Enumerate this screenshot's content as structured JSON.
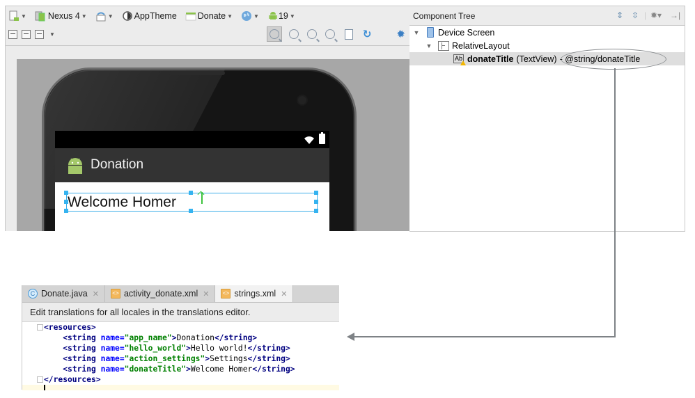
{
  "designer": {
    "toolbar_row1": {
      "device": "Nexus 4",
      "theme": "AppTheme",
      "activity": "Donate",
      "api_level": "19"
    },
    "toolbar_row2": {
      "icons": [
        "zoom-to-fit",
        "actual-size",
        "zoom-in",
        "zoom-out",
        "screenshot",
        "refresh",
        "settings"
      ]
    },
    "preview": {
      "app_title": "Donation",
      "selected_text": "Welcome Homer"
    }
  },
  "component_tree": {
    "title": "Component Tree",
    "items": [
      {
        "label": "Device Screen",
        "level": 0
      },
      {
        "label": "RelativeLayout",
        "level": 1
      },
      {
        "label": "donateTitle",
        "type": "(TextView)",
        "value": "- @string/donateTitle",
        "level": 2,
        "selected": true
      }
    ]
  },
  "editor": {
    "tabs": [
      {
        "label": "Donate.java",
        "icon": "C"
      },
      {
        "label": "activity_donate.xml",
        "icon": "xml"
      },
      {
        "label": "strings.xml",
        "icon": "xml",
        "active": true
      }
    ],
    "notice": "Edit translations for all locales in the translations editor.",
    "code": {
      "open_tag": "<resources>",
      "close_tag": "</resources>",
      "strings": [
        {
          "name": "app_name",
          "value": "Donation"
        },
        {
          "name": "hello_world",
          "value": "Hello world!"
        },
        {
          "name": "action_settings",
          "value": "Settings"
        },
        {
          "name": "donateTitle",
          "value": "Welcome Homer"
        }
      ]
    }
  },
  "colors": {
    "selection": "#3daee9",
    "xml_tag": "#000080",
    "xml_attr": "#0000ff",
    "xml_value": "#008000",
    "connector": "#7e8286"
  }
}
